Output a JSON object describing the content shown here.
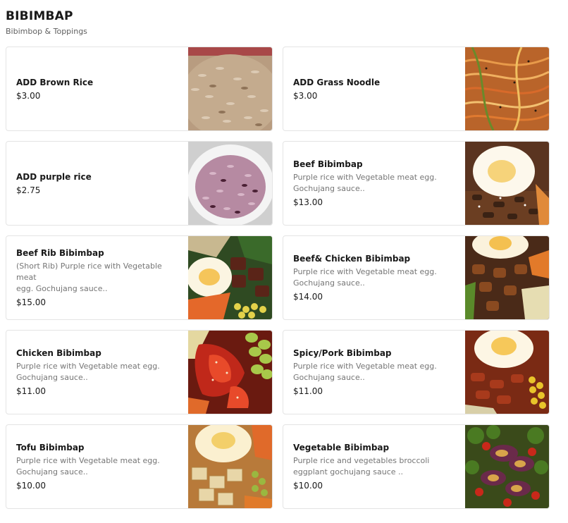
{
  "section": {
    "title": "BIBIMBAP",
    "subtitle": "Bibimbop & Toppings"
  },
  "items": [
    {
      "name": "ADD Brown Rice",
      "description": "",
      "price": "$3.00",
      "image": "brown-rice-photo"
    },
    {
      "name": "ADD Grass Noodle",
      "description": "",
      "price": "$3.00",
      "image": "glass-noodle-photo"
    },
    {
      "name": "ADD purple rice",
      "description": "",
      "price": "$2.75",
      "image": "purple-rice-photo"
    },
    {
      "name": "Beef Bibimbap",
      "description": "Purple rice with Vegetable meat egg.\nGochujang sauce..",
      "price": "$13.00",
      "image": "beef-bibimbap-photo"
    },
    {
      "name": "Beef Rib Bibimbap",
      "description": "(Short Rib) Purple rice with Vegetable meat\negg. Gochujang sauce..",
      "price": "$15.00",
      "image": "beef-rib-bibimbap-photo"
    },
    {
      "name": "Beef& Chicken Bibimbap",
      "description": "Purple rice with Vegetable meat egg.\nGochujang sauce..",
      "price": "$14.00",
      "image": "beef-chicken-bibimbap-photo"
    },
    {
      "name": "Chicken Bibimbap",
      "description": "Purple rice with Vegetable meat egg.\nGochujang sauce..",
      "price": "$11.00",
      "image": "chicken-bibimbap-photo"
    },
    {
      "name": "Spicy/Pork Bibimbap",
      "description": "Purple rice with Vegetable meat egg.\nGochujang sauce..",
      "price": "$11.00",
      "image": "spicy-pork-bibimbap-photo"
    },
    {
      "name": "Tofu Bibimbap",
      "description": "Purple rice with Vegetable meat egg.\nGochujang sauce..",
      "price": "$10.00",
      "image": "tofu-bibimbap-photo"
    },
    {
      "name": "Vegetable Bibimbap",
      "description": "Purple rice and vegetables broccoli\neggplant gochujang sauce ..",
      "price": "$10.00",
      "image": "vegetable-bibimbap-photo"
    }
  ]
}
